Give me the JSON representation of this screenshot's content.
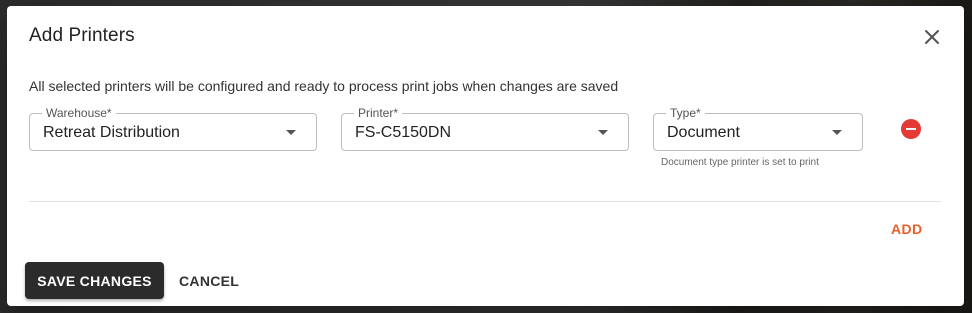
{
  "dialog": {
    "title": "Add Printers",
    "description": "All selected printers will be configured and ready to process print jobs when changes are saved",
    "fields": {
      "warehouse": {
        "label": "Warehouse",
        "required_mark": "*",
        "value": "Retreat Distribution"
      },
      "printer": {
        "label": "Printer",
        "required_mark": "*",
        "value": "FS-C5150DN"
      },
      "type": {
        "label": "Type",
        "required_mark": "*",
        "value": "Document",
        "helper": "Document type printer is set to print"
      }
    },
    "add_label": "ADD",
    "save_label": "SAVE CHANGES",
    "cancel_label": "CANCEL",
    "icons": {
      "close": "close-icon",
      "remove": "remove-circle-icon",
      "dropdown": "chevron-down-icon"
    },
    "colors": {
      "accent": "#e8612c",
      "remove": "#e53935",
      "primary_button": "#2b2b2b"
    }
  }
}
